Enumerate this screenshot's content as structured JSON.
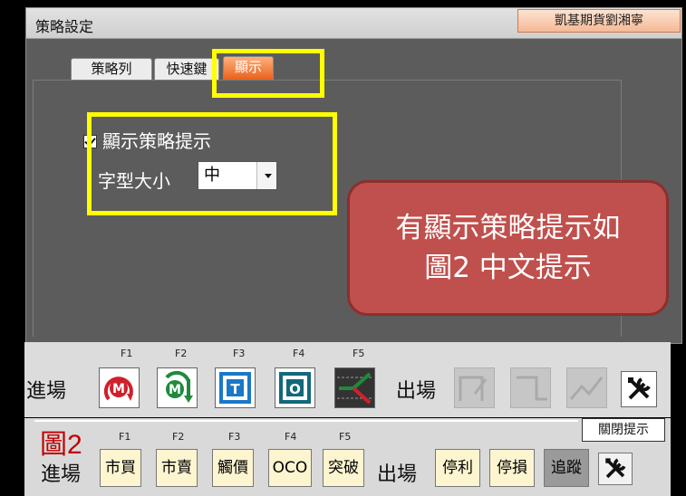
{
  "window": {
    "title": "策略設定",
    "brand": "凱基期貨劉湘寧"
  },
  "tabs": [
    {
      "label": "策略列"
    },
    {
      "label": "快速鍵"
    },
    {
      "label": "顯示"
    }
  ],
  "display": {
    "show_hint_label": "顯示策略提示",
    "show_hint_checked": true,
    "font_size_label": "字型大小",
    "font_size_value": "中"
  },
  "callout": {
    "line1": "有顯示策略提示如",
    "line2": "圖2 中文提示"
  },
  "toolbar1": {
    "entry_label": "進場",
    "exit_label": "出場",
    "fkeys": [
      "F1",
      "F2",
      "F3",
      "F4",
      "F5"
    ],
    "entry_buttons": [
      {
        "icon": "market-buy-icon",
        "fkey": "F1"
      },
      {
        "icon": "market-sell-icon",
        "fkey": "F2"
      },
      {
        "icon": "touch-price-icon",
        "fkey": "F3"
      },
      {
        "icon": "oco-icon",
        "fkey": "F4"
      },
      {
        "icon": "breakout-icon",
        "fkey": "F5"
      }
    ],
    "exit_buttons": [
      {
        "icon": "take-profit-icon",
        "disabled": true
      },
      {
        "icon": "stop-loss-icon",
        "disabled": true
      },
      {
        "icon": "trailing-stop-icon",
        "disabled": true
      }
    ],
    "tools_icon": "tools-icon"
  },
  "toolbar2": {
    "figure_label": "圖2",
    "entry_label": "進場",
    "exit_label": "出場",
    "fkeys": [
      "F1",
      "F2",
      "F3",
      "F4",
      "F5"
    ],
    "entry_buttons": [
      "市買",
      "市賣",
      "觸價",
      "OCO",
      "突破"
    ],
    "exit_buttons": [
      "停利",
      "停損",
      "追蹤"
    ],
    "tooltip": "關閉提示",
    "tools_icon": "tools-icon"
  },
  "colors": {
    "highlight": "#ffff00",
    "callout": "#c0504d",
    "active_tab": "#e8611e",
    "figure_label": "#c00000"
  }
}
